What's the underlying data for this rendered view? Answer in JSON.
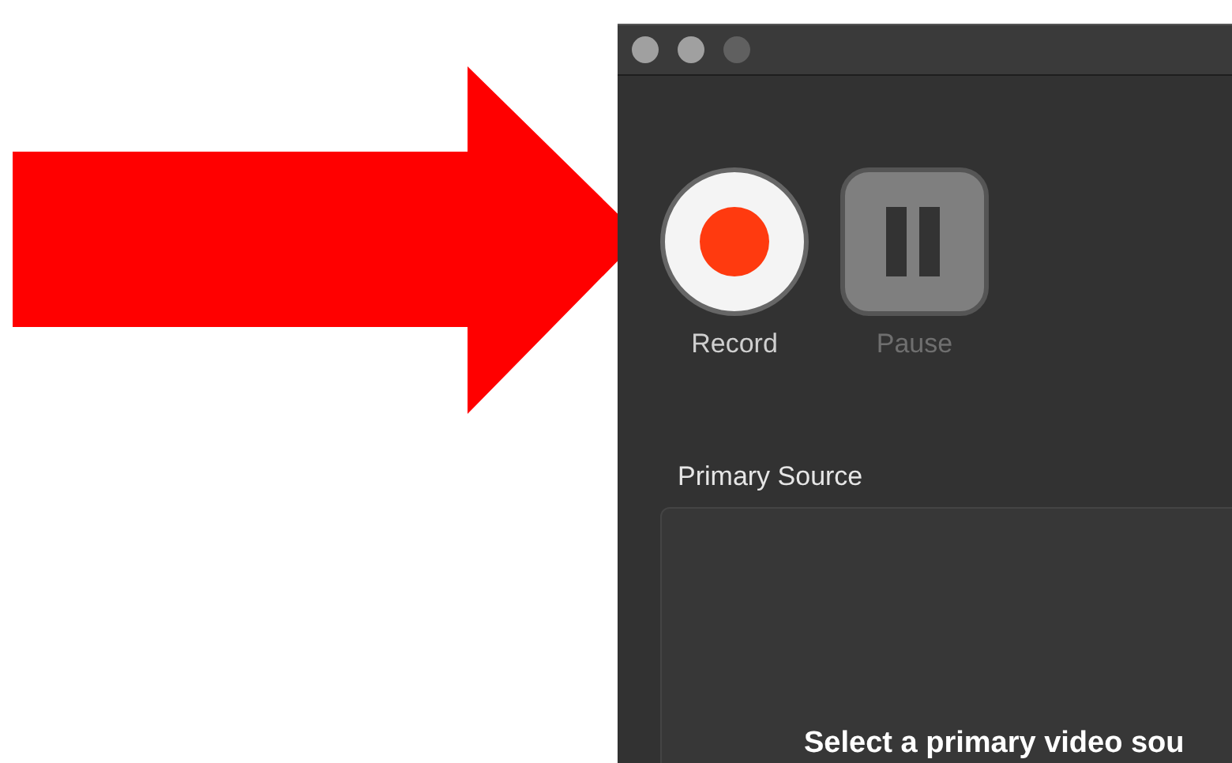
{
  "annotation": {
    "kind": "arrow"
  },
  "window": {
    "controls": [
      {
        "disabled": false
      },
      {
        "disabled": false
      },
      {
        "disabled": true
      }
    ]
  },
  "buttons": [
    {
      "kind": "record",
      "label": "Record",
      "disabled": false
    },
    {
      "kind": "pause",
      "label": "Pause",
      "disabled": true
    }
  ],
  "primary_source": {
    "heading": "Primary Source",
    "message": "Select a primary video sou"
  }
}
